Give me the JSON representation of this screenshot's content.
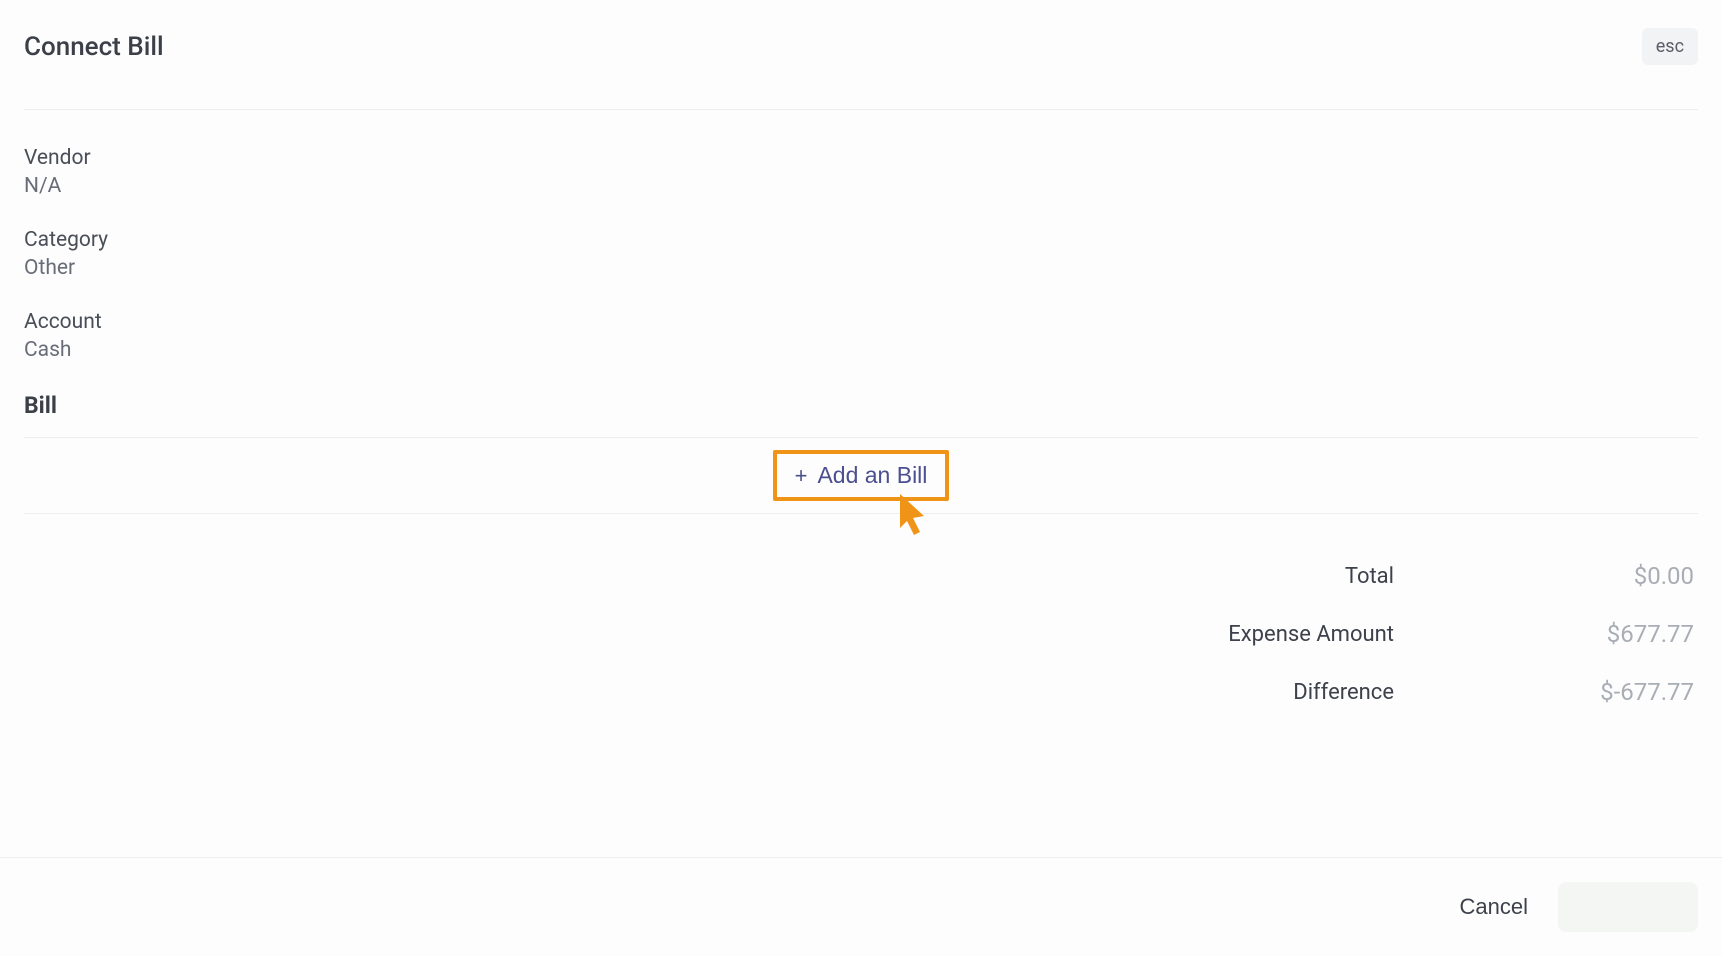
{
  "header": {
    "title": "Connect Bill",
    "esc_label": "esc"
  },
  "fields": {
    "vendor": {
      "label": "Vendor",
      "value": "N/A"
    },
    "category": {
      "label": "Category",
      "value": "Other"
    },
    "account": {
      "label": "Account",
      "value": "Cash"
    }
  },
  "bill_section": {
    "heading": "Bill",
    "add_button": {
      "plus": "+",
      "label": "Add an Bill"
    }
  },
  "totals": {
    "total": {
      "label": "Total",
      "value": "$0.00"
    },
    "expense_amount": {
      "label": "Expense Amount",
      "value": "$677.77"
    },
    "difference": {
      "label": "Difference",
      "value": "$-677.77"
    }
  },
  "footer": {
    "cancel_label": "Cancel",
    "save_label": ""
  }
}
